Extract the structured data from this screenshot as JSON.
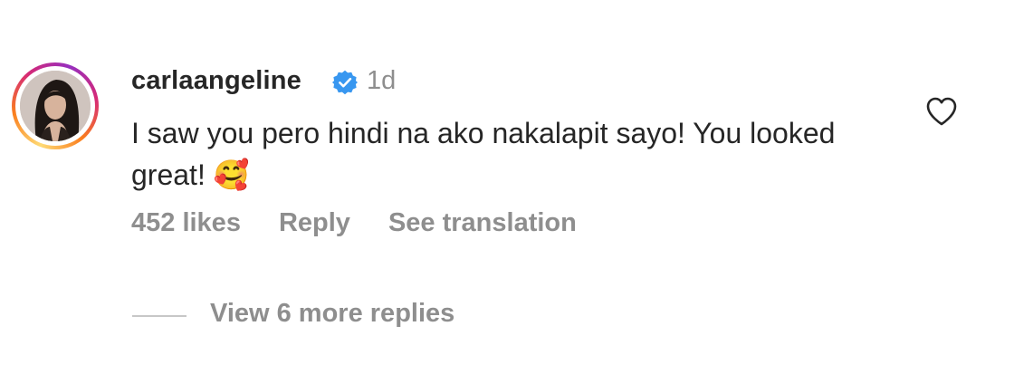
{
  "comment": {
    "username": "carlaangeline",
    "verified_icon": "verified-badge-icon",
    "time_ago": "1d",
    "text": "I saw you pero hindi na ako nakalapit sayo! You looked great!",
    "emoji": "🥰",
    "likes": "452 likes",
    "reply_label": "Reply",
    "translate_label": "See translation",
    "like_icon": "heart-outline-icon",
    "view_replies_label": "View 6 more replies"
  },
  "colors": {
    "text_primary": "#262626",
    "text_secondary": "#8e8e8e",
    "verified_blue": "#3897f0"
  }
}
